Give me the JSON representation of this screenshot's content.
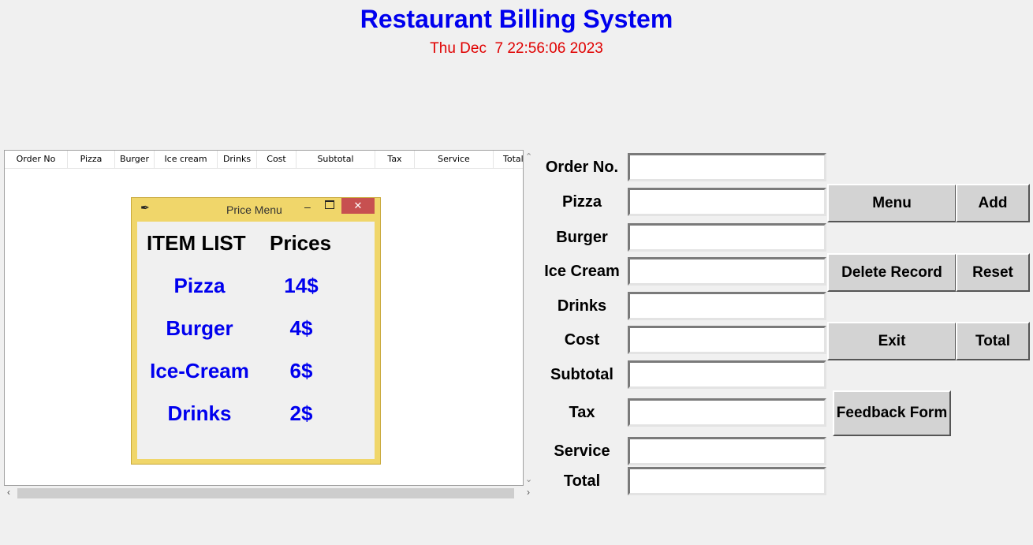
{
  "header": {
    "title": "Restaurant Billing System",
    "datetime": "Thu Dec  7 22:56:06 2023"
  },
  "table": {
    "columns": [
      "Order No",
      "Pizza",
      "Burger",
      "Ice cream",
      "Drinks",
      "Cost",
      "Subtotal",
      "Tax",
      "Service",
      "Total"
    ],
    "rows": []
  },
  "price_menu": {
    "window_title": "Price Menu",
    "header_items": "ITEM LIST",
    "header_prices": "Prices",
    "items": [
      {
        "name": "Pizza",
        "price": "14$"
      },
      {
        "name": "Burger",
        "price": "4$"
      },
      {
        "name": "Ice-Cream",
        "price": "6$"
      },
      {
        "name": "Drinks",
        "price": "2$"
      }
    ]
  },
  "form": {
    "labels": {
      "order_no": "Order No.",
      "pizza": "Pizza",
      "burger": "Burger",
      "ice_cream": "Ice Cream",
      "drinks": "Drinks",
      "cost": "Cost",
      "subtotal": "Subtotal",
      "tax": "Tax",
      "service": "Service",
      "total": "Total"
    },
    "values": {
      "order_no": "",
      "pizza": "",
      "burger": "",
      "ice_cream": "",
      "drinks": "",
      "cost": "",
      "subtotal": "",
      "tax": "",
      "service": "",
      "total": ""
    }
  },
  "buttons": {
    "menu": "Menu",
    "add": "Add",
    "delete_record": "Delete Record",
    "reset": "Reset",
    "exit": "Exit",
    "total": "Total",
    "feedback_form": "Feedback Form"
  },
  "colors": {
    "title": "#0000ee",
    "datetime": "#e00000",
    "menu_items": "#0000ee",
    "popup_frame": "#f0d66a",
    "close_button": "#c75050"
  },
  "icons": {
    "popup_icon": "feather-icon",
    "minimize": "minimize-icon",
    "maximize": "maximize-icon",
    "close": "close-icon"
  }
}
